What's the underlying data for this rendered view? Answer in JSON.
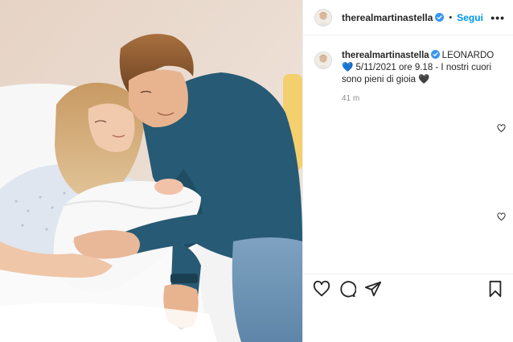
{
  "post": {
    "username": "therealmartinastella",
    "follow_label": "Segui",
    "separator": "•",
    "more_label": "•••",
    "caption_text": "LEONARDO 💙 5/11/2021 ore 9.18 - I nostri cuori sono pieni di gioia 🖤",
    "time_ago": "41 m"
  },
  "icons": {
    "verified": "verified-badge-icon",
    "like": "heart-icon",
    "comment": "comment-bubble-icon",
    "share": "paper-plane-icon",
    "save": "bookmark-icon"
  },
  "colors": {
    "link_blue": "#0095f6",
    "verified_blue": "#3897f0",
    "muted_text": "#8e8e8e",
    "border": "#efefef"
  }
}
